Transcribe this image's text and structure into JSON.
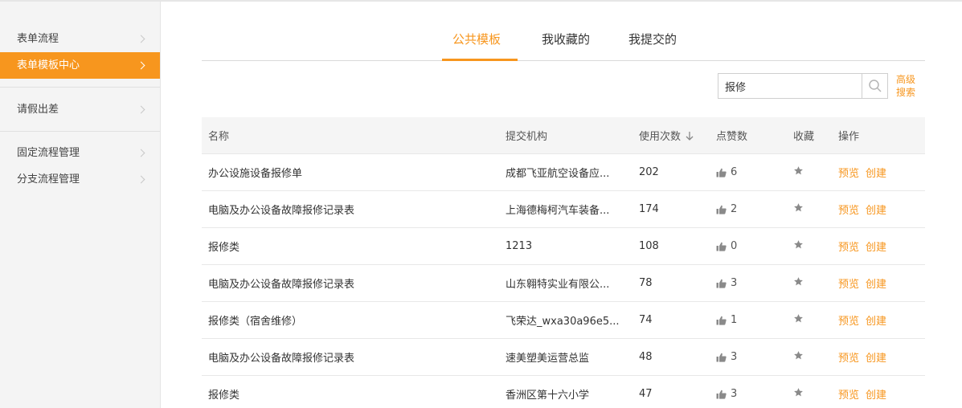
{
  "sidebar": {
    "groups": [
      {
        "items": [
          {
            "label": "表单流程",
            "active": false
          },
          {
            "label": "表单模板中心",
            "active": true
          }
        ]
      },
      {
        "items": [
          {
            "label": "请假出差",
            "active": false
          }
        ]
      },
      {
        "items": [
          {
            "label": "固定流程管理",
            "active": false
          },
          {
            "label": "分支流程管理",
            "active": false
          }
        ]
      }
    ]
  },
  "tabs": [
    {
      "label": "公共模板",
      "active": true
    },
    {
      "label": "我收藏的",
      "active": false
    },
    {
      "label": "我提交的",
      "active": false
    }
  ],
  "search": {
    "value": "报修",
    "advanced_line1": "高级",
    "advanced_line2": "搜索"
  },
  "table": {
    "headers": {
      "name": "名称",
      "org": "提交机构",
      "used": "使用次数",
      "likes": "点赞数",
      "fav": "收藏",
      "ops": "操作"
    },
    "ops": {
      "preview": "预览",
      "create": "创建"
    },
    "rows": [
      {
        "name": "办公设施设备报修单",
        "org": "成都飞亚航空设备应...",
        "used": "202",
        "likes": "6"
      },
      {
        "name": "电脑及办公设备故障报修记录表",
        "org": "上海德梅柯汽车装备...",
        "used": "174",
        "likes": "2"
      },
      {
        "name": "报修类",
        "org": "1213",
        "used": "108",
        "likes": "0"
      },
      {
        "name": "电脑及办公设备故障报修记录表",
        "org": "山东翱特实业有限公...",
        "used": "78",
        "likes": "3"
      },
      {
        "name": "报修类（宿舍维修）",
        "org": "飞荣达_wxa30a96e5...",
        "used": "74",
        "likes": "1"
      },
      {
        "name": "电脑及办公设备故障报修记录表",
        "org": "速美塑美运营总监",
        "used": "48",
        "likes": "3"
      },
      {
        "name": "报修类",
        "org": "香洲区第十六小学",
        "used": "47",
        "likes": "3"
      }
    ]
  },
  "colors": {
    "accent": "#f7961e",
    "sidebar_bg": "#f4f4f4",
    "header_bg": "#f5f5f5"
  }
}
